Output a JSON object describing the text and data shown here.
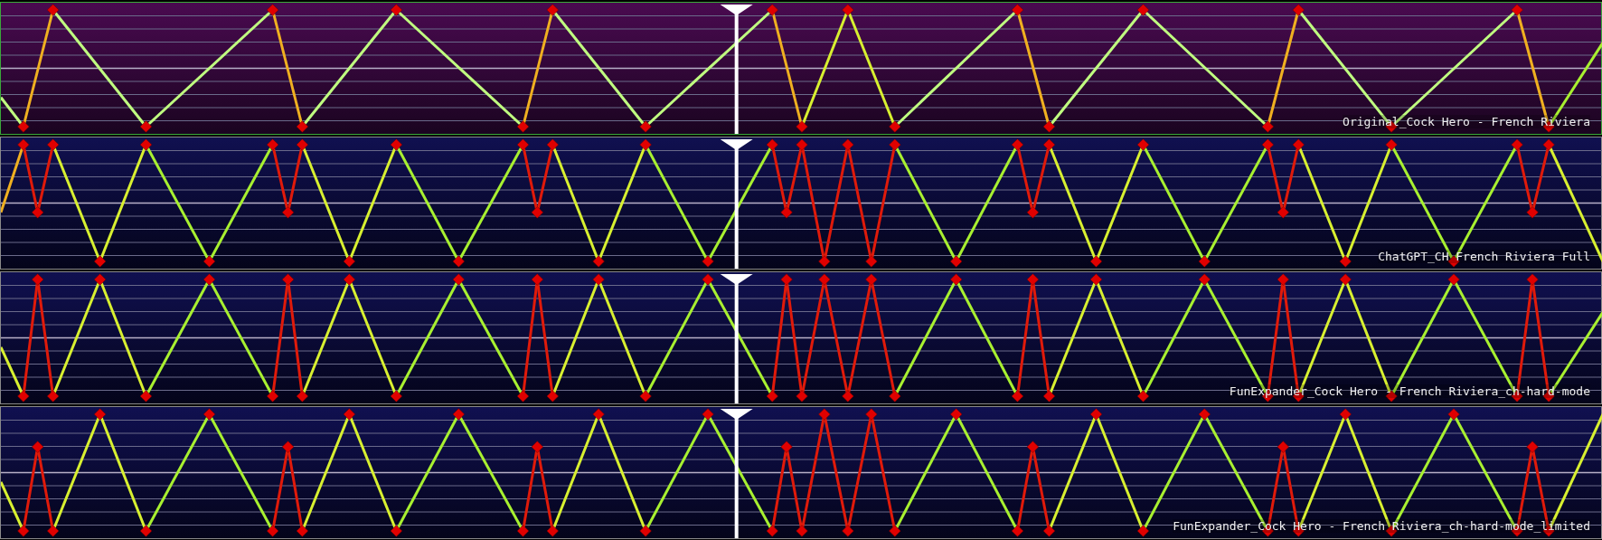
{
  "tracks": [
    {
      "label": "Original_Cock Hero - French Riviera",
      "selected": true
    },
    {
      "label": "ChatGPT_CH French Riviera Full",
      "selected": false
    },
    {
      "label": "FunExpander_Cock Hero - French Riviera_ch-hard-mode",
      "selected": false
    },
    {
      "label": "FunExpander_Cock Hero - French Riviera_ch-hard-mode_limited",
      "selected": false
    }
  ]
}
